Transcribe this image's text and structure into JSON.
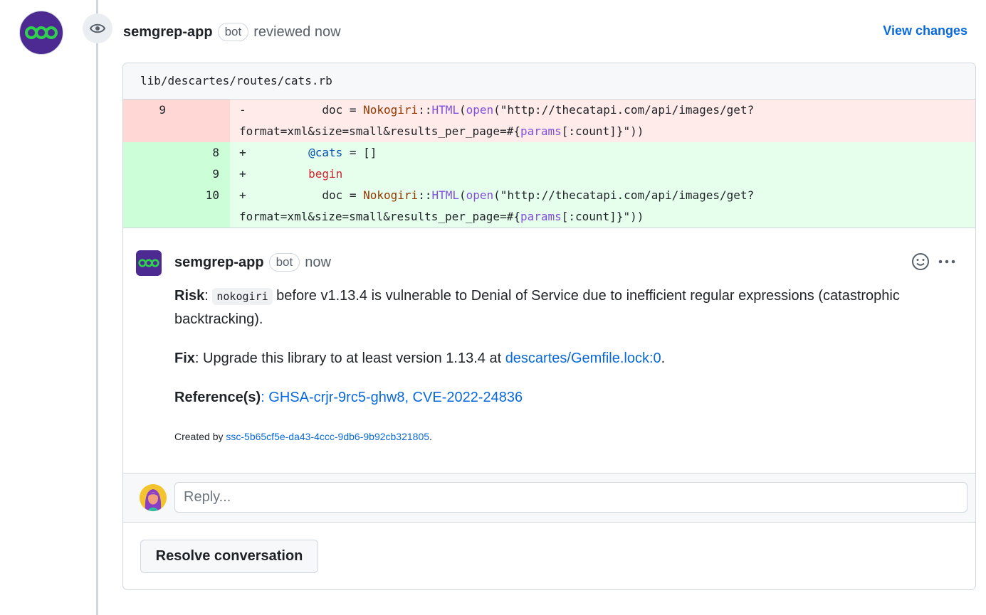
{
  "review": {
    "author": "semgrep-app",
    "bot_label": "bot",
    "action_text": "reviewed now",
    "view_changes_label": "View changes"
  },
  "file": {
    "path": "lib/descartes/routes/cats.rb"
  },
  "diff": {
    "removed": {
      "old_num": "9",
      "marker": "-",
      "indent": "          ",
      "var": "doc = ",
      "const": "Nokogiri",
      "sep": "::",
      "method": "HTML",
      "paren": "(",
      "open": "open",
      "str1": "(\"http://thecatapi.com/api/images/get?",
      "cont_prefix": "format=xml&size=small&results_per_page=#{",
      "params": "params",
      "cont_suffix": "[:count]}\"))"
    },
    "added": [
      {
        "new_num": "8",
        "marker": "+",
        "indent": "        ",
        "ivar": "@cats",
        "rest": " = []"
      },
      {
        "new_num": "9",
        "marker": "+",
        "indent": "        ",
        "kw": "begin"
      },
      {
        "new_num": "10",
        "marker": "+",
        "indent": "          ",
        "var": "doc = ",
        "const": "Nokogiri",
        "sep": "::",
        "method": "HTML",
        "paren": "(",
        "open": "open",
        "str1": "(\"http://thecatapi.com/api/images/get?",
        "cont_prefix": "format=xml&size=small&results_per_page=#{",
        "params": "params",
        "cont_suffix": "[:count]}\"))"
      }
    ]
  },
  "comment": {
    "author": "semgrep-app",
    "bot_label": "bot",
    "time": "now",
    "risk_label": "Risk",
    "risk_colon": ":",
    "risk_code": "nokogiri",
    "risk_text": " before v1.13.4 is vulnerable to Denial of Service due to inefficient regular expressions (catastrophic backtracking).",
    "fix_label": "Fix",
    "fix_text": ": Upgrade this library to at least version 1.13.4 at ",
    "fix_link": "descartes/Gemfile.lock:0",
    "fix_end": ".",
    "ref_label": "Reference(s)",
    "ref_colon": ": ",
    "ref_links": "GHSA-crjr-9rc5-ghw8, CVE-2022-24836",
    "created_prefix": "Created by ",
    "created_link": "ssc-5b65cf5e-da43-4ccc-9db6-9b92cb321805",
    "created_end": "."
  },
  "reply": {
    "placeholder": "Reply..."
  },
  "resolve_label": "Resolve conversation",
  "colors": {
    "accent": "#0969da",
    "avatar_bg": "#4c2a92",
    "logo_green": "#2fd14f",
    "deletion_bg": "#ffebe9",
    "addition_bg": "#e6ffec"
  }
}
